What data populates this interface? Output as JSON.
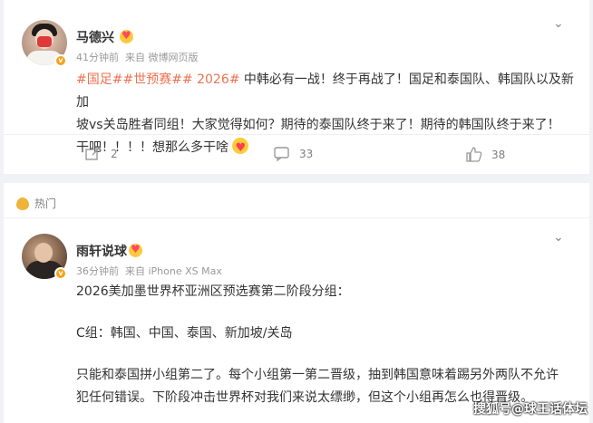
{
  "post1": {
    "author": "马德兴",
    "time": "41分钟前",
    "source": "来自 微博网页版",
    "tags": "#国足##世预赛## 2026#",
    "text_line1": " 中韩必有一战！终于再战了！国足和泰国队、韩国队以及新加",
    "text_line2": "坡vs关岛胜者同组！大家觉得如何？期待的泰国队终于来了！期待的韩国队终于来了！",
    "text_line3": "干吧！！！！想那么多干啥",
    "repost_count": "2",
    "comment_count": "33",
    "like_count": "38"
  },
  "hot_section": {
    "label": "热门"
  },
  "post2": {
    "author": "雨轩说球",
    "time": "36分钟前",
    "source": "来自 iPhone XS Max",
    "line1": "2026美加墨世界杯亚洲区预选赛第二阶段分组：",
    "line2": "C组：韩国、中国、泰国、新加坡/关岛",
    "line3": "只能和泰国拼小组第二了。每个小组第一第二晋级，抽到韩国意味着踢另外两队不允许",
    "line4": "犯任何错误。下阶段冲击世界杯对我们来说太缥缈，但这个小组再怎么也得晋级。"
  },
  "watermark": "搜狐号@球王话体坛",
  "colors": {
    "tag": "#eb7350",
    "badge": "#f7a21b",
    "background": "#f1f2f5"
  }
}
